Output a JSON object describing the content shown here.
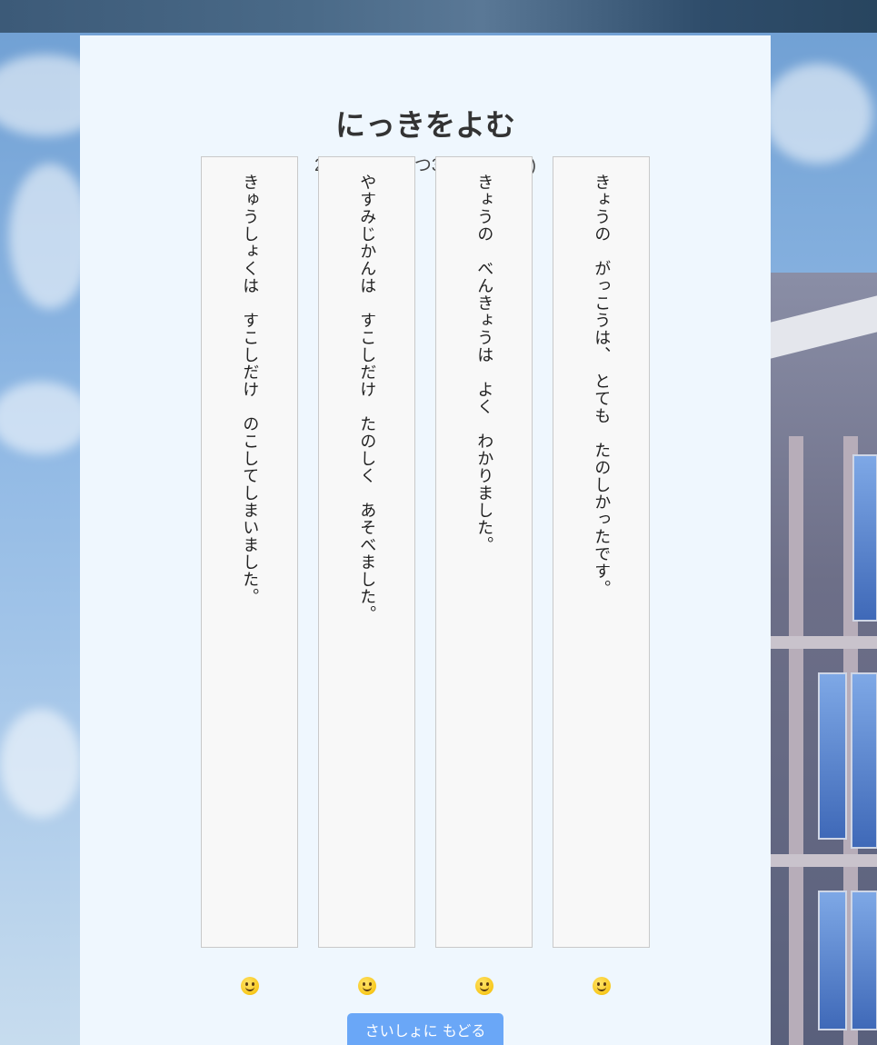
{
  "page": {
    "title": "にっきをよむ",
    "date": "2024ねん6がつ30にち (にち)"
  },
  "entries": [
    {
      "text": "きょうの　がっこうは、　とても　たのしかったです。",
      "emoji": "laughing-tongue-face",
      "emoji_char": "😝"
    },
    {
      "text": "きょうの　べんきょうは　よく　わかりました。",
      "emoji": "smiling-face",
      "emoji_char": "😊"
    },
    {
      "text": "やすみじかんは　すこしだけ　たのしく　あそべました。",
      "emoji": "grinning-face",
      "emoji_char": "😀"
    },
    {
      "text": "きゅうしょくは　すこしだけ　のこしてしまいました。",
      "emoji": "tongue-face",
      "emoji_char": "😋"
    }
  ],
  "back_button": {
    "label": "さいしょに もどる"
  },
  "colors": {
    "panel_bg": "#eff7fe",
    "entry_bg": "#f8f8f8",
    "button_bg": "#6aa7f7",
    "title_text": "#333333"
  }
}
